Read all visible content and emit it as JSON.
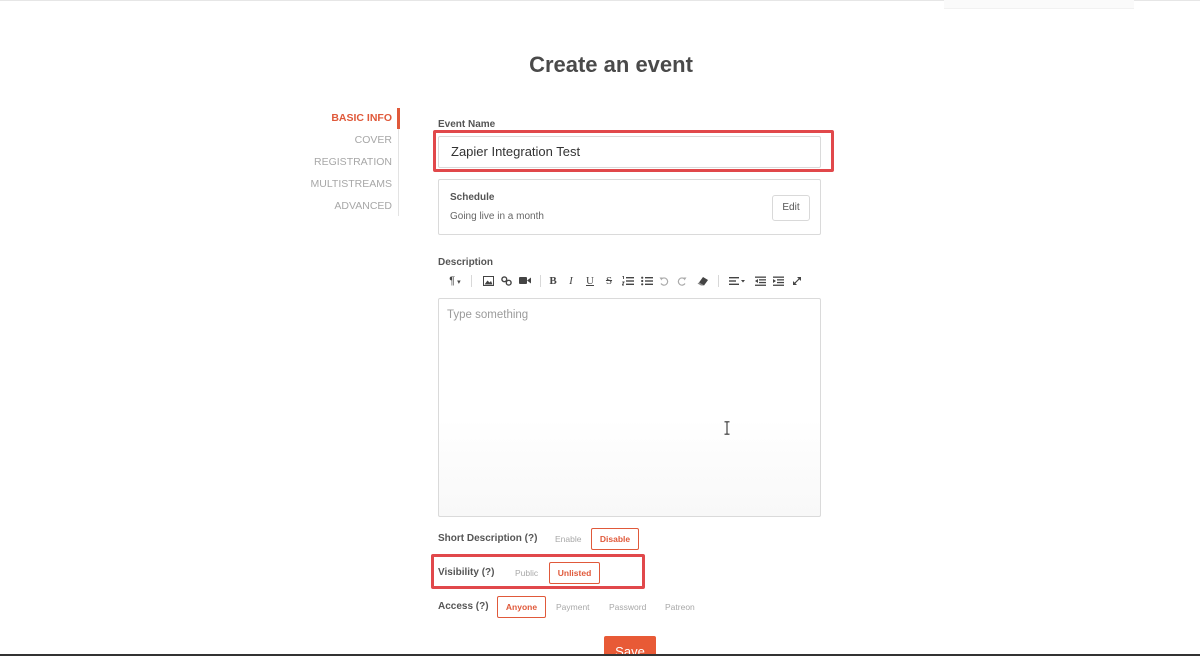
{
  "page": {
    "title": "Create an event"
  },
  "nav": {
    "items": [
      {
        "label": "BASIC INFO",
        "active": true
      },
      {
        "label": "COVER",
        "active": false
      },
      {
        "label": "REGISTRATION",
        "active": false
      },
      {
        "label": "MULTISTREAMS",
        "active": false
      },
      {
        "label": "ADVANCED",
        "active": false
      }
    ]
  },
  "event_name": {
    "label": "Event Name",
    "value": "Zapier Integration Test"
  },
  "schedule": {
    "title": "Schedule",
    "subtitle": "Going live in a month",
    "edit_label": "Edit"
  },
  "description": {
    "label": "Description",
    "placeholder": "Type something",
    "toolbar": {
      "paragraph": "¶",
      "bold": "B",
      "italic": "I",
      "underline": "U",
      "strikethrough": "S"
    }
  },
  "short_description": {
    "label": "Short Description (?)",
    "options": [
      "Enable",
      "Disable"
    ],
    "selected": "Disable"
  },
  "visibility": {
    "label": "Visibility (?)",
    "options": [
      "Public",
      "Unlisted"
    ],
    "selected": "Unlisted"
  },
  "access": {
    "label": "Access (?)",
    "options": [
      "Anyone",
      "Payment",
      "Password",
      "Patreon"
    ],
    "selected": "Anyone"
  },
  "actions": {
    "save_label": "Save"
  },
  "colors": {
    "accent": "#e0593a",
    "highlight": "#e1484b",
    "save": "#e85a36"
  }
}
